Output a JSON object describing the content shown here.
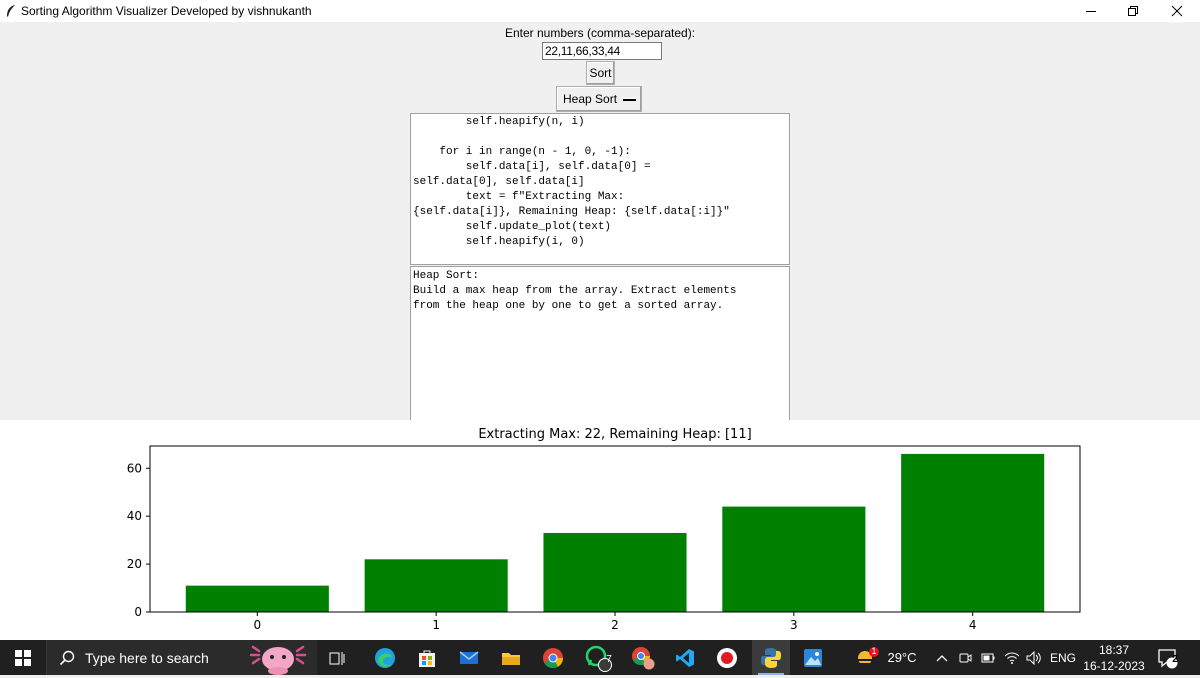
{
  "window": {
    "title": "Sorting Algorithm Visualizer Developed by vishnukanth",
    "app_icon": "feather-icon"
  },
  "controls": {
    "prompt": "Enter numbers (comma-separated):",
    "input_value": "22,11,66,33,44",
    "sort_label": "Sort",
    "algorithm_selected": "Heap Sort"
  },
  "code_lines": [
    "        self.heapify(n, i)",
    "",
    "    for i in range(n - 1, 0, -1):",
    "        self.data[i], self.data[0] =",
    "self.data[0], self.data[i]",
    "        text = f\"Extracting Max:",
    "{self.data[i]}, Remaining Heap: {self.data[:i]}\"",
    "        self.update_plot(text)",
    "        self.heapify(i, 0)"
  ],
  "description_lines": [
    "Heap Sort:",
    "Build a max heap from the array. Extract elements",
    "from the heap one by one to get a sorted array."
  ],
  "chart_data": {
    "type": "bar",
    "title": "Extracting Max: 22, Remaining Heap: [11]",
    "categories": [
      "0",
      "1",
      "2",
      "3",
      "4"
    ],
    "values": [
      11,
      22,
      33,
      44,
      66
    ],
    "y_ticks": [
      "0",
      "20",
      "40",
      "60"
    ],
    "ylim": [
      0,
      69.3
    ],
    "bar_color": "#008000",
    "xlabel": "",
    "ylabel": ""
  },
  "taskbar": {
    "search_placeholder": "Type here to search",
    "weather_temp": "29°C",
    "weather_badge": "1",
    "language": "ENG",
    "time": "18:37",
    "date": "16-12-2023",
    "whatsapp_badge": "7",
    "notification_count": "2",
    "pinned_apps": [
      "task-view-icon",
      "edge-icon",
      "store-icon",
      "mail-icon",
      "file-explorer-icon",
      "chrome-icon",
      "whatsapp-icon",
      "chrome-profile-icon",
      "vscode-icon",
      "record-icon",
      "python-icon",
      "photos-icon"
    ]
  }
}
